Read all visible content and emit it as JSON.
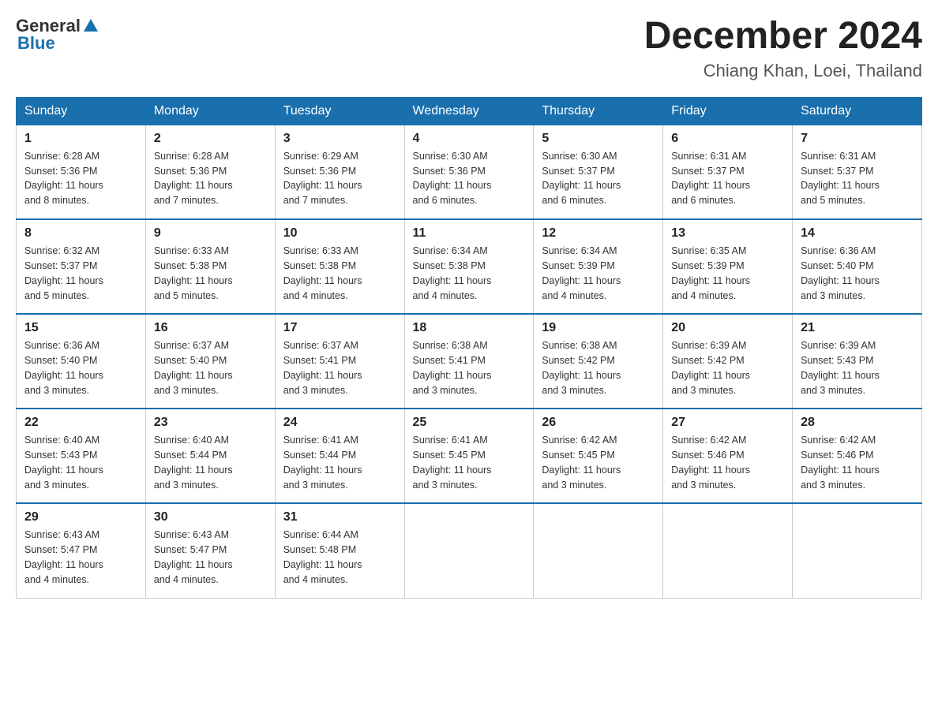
{
  "header": {
    "logo_general": "General",
    "logo_blue": "Blue",
    "title": "December 2024",
    "subtitle": "Chiang Khan, Loei, Thailand"
  },
  "weekdays": [
    "Sunday",
    "Monday",
    "Tuesday",
    "Wednesday",
    "Thursday",
    "Friday",
    "Saturday"
  ],
  "weeks": [
    [
      {
        "day": "1",
        "sunrise": "6:28 AM",
        "sunset": "5:36 PM",
        "daylight": "11 hours and 8 minutes."
      },
      {
        "day": "2",
        "sunrise": "6:28 AM",
        "sunset": "5:36 PM",
        "daylight": "11 hours and 7 minutes."
      },
      {
        "day": "3",
        "sunrise": "6:29 AM",
        "sunset": "5:36 PM",
        "daylight": "11 hours and 7 minutes."
      },
      {
        "day": "4",
        "sunrise": "6:30 AM",
        "sunset": "5:36 PM",
        "daylight": "11 hours and 6 minutes."
      },
      {
        "day": "5",
        "sunrise": "6:30 AM",
        "sunset": "5:37 PM",
        "daylight": "11 hours and 6 minutes."
      },
      {
        "day": "6",
        "sunrise": "6:31 AM",
        "sunset": "5:37 PM",
        "daylight": "11 hours and 6 minutes."
      },
      {
        "day": "7",
        "sunrise": "6:31 AM",
        "sunset": "5:37 PM",
        "daylight": "11 hours and 5 minutes."
      }
    ],
    [
      {
        "day": "8",
        "sunrise": "6:32 AM",
        "sunset": "5:37 PM",
        "daylight": "11 hours and 5 minutes."
      },
      {
        "day": "9",
        "sunrise": "6:33 AM",
        "sunset": "5:38 PM",
        "daylight": "11 hours and 5 minutes."
      },
      {
        "day": "10",
        "sunrise": "6:33 AM",
        "sunset": "5:38 PM",
        "daylight": "11 hours and 4 minutes."
      },
      {
        "day": "11",
        "sunrise": "6:34 AM",
        "sunset": "5:38 PM",
        "daylight": "11 hours and 4 minutes."
      },
      {
        "day": "12",
        "sunrise": "6:34 AM",
        "sunset": "5:39 PM",
        "daylight": "11 hours and 4 minutes."
      },
      {
        "day": "13",
        "sunrise": "6:35 AM",
        "sunset": "5:39 PM",
        "daylight": "11 hours and 4 minutes."
      },
      {
        "day": "14",
        "sunrise": "6:36 AM",
        "sunset": "5:40 PM",
        "daylight": "11 hours and 3 minutes."
      }
    ],
    [
      {
        "day": "15",
        "sunrise": "6:36 AM",
        "sunset": "5:40 PM",
        "daylight": "11 hours and 3 minutes."
      },
      {
        "day": "16",
        "sunrise": "6:37 AM",
        "sunset": "5:40 PM",
        "daylight": "11 hours and 3 minutes."
      },
      {
        "day": "17",
        "sunrise": "6:37 AM",
        "sunset": "5:41 PM",
        "daylight": "11 hours and 3 minutes."
      },
      {
        "day": "18",
        "sunrise": "6:38 AM",
        "sunset": "5:41 PM",
        "daylight": "11 hours and 3 minutes."
      },
      {
        "day": "19",
        "sunrise": "6:38 AM",
        "sunset": "5:42 PM",
        "daylight": "11 hours and 3 minutes."
      },
      {
        "day": "20",
        "sunrise": "6:39 AM",
        "sunset": "5:42 PM",
        "daylight": "11 hours and 3 minutes."
      },
      {
        "day": "21",
        "sunrise": "6:39 AM",
        "sunset": "5:43 PM",
        "daylight": "11 hours and 3 minutes."
      }
    ],
    [
      {
        "day": "22",
        "sunrise": "6:40 AM",
        "sunset": "5:43 PM",
        "daylight": "11 hours and 3 minutes."
      },
      {
        "day": "23",
        "sunrise": "6:40 AM",
        "sunset": "5:44 PM",
        "daylight": "11 hours and 3 minutes."
      },
      {
        "day": "24",
        "sunrise": "6:41 AM",
        "sunset": "5:44 PM",
        "daylight": "11 hours and 3 minutes."
      },
      {
        "day": "25",
        "sunrise": "6:41 AM",
        "sunset": "5:45 PM",
        "daylight": "11 hours and 3 minutes."
      },
      {
        "day": "26",
        "sunrise": "6:42 AM",
        "sunset": "5:45 PM",
        "daylight": "11 hours and 3 minutes."
      },
      {
        "day": "27",
        "sunrise": "6:42 AM",
        "sunset": "5:46 PM",
        "daylight": "11 hours and 3 minutes."
      },
      {
        "day": "28",
        "sunrise": "6:42 AM",
        "sunset": "5:46 PM",
        "daylight": "11 hours and 3 minutes."
      }
    ],
    [
      {
        "day": "29",
        "sunrise": "6:43 AM",
        "sunset": "5:47 PM",
        "daylight": "11 hours and 4 minutes."
      },
      {
        "day": "30",
        "sunrise": "6:43 AM",
        "sunset": "5:47 PM",
        "daylight": "11 hours and 4 minutes."
      },
      {
        "day": "31",
        "sunrise": "6:44 AM",
        "sunset": "5:48 PM",
        "daylight": "11 hours and 4 minutes."
      },
      null,
      null,
      null,
      null
    ]
  ],
  "labels": {
    "sunrise": "Sunrise:",
    "sunset": "Sunset:",
    "daylight": "Daylight:"
  }
}
